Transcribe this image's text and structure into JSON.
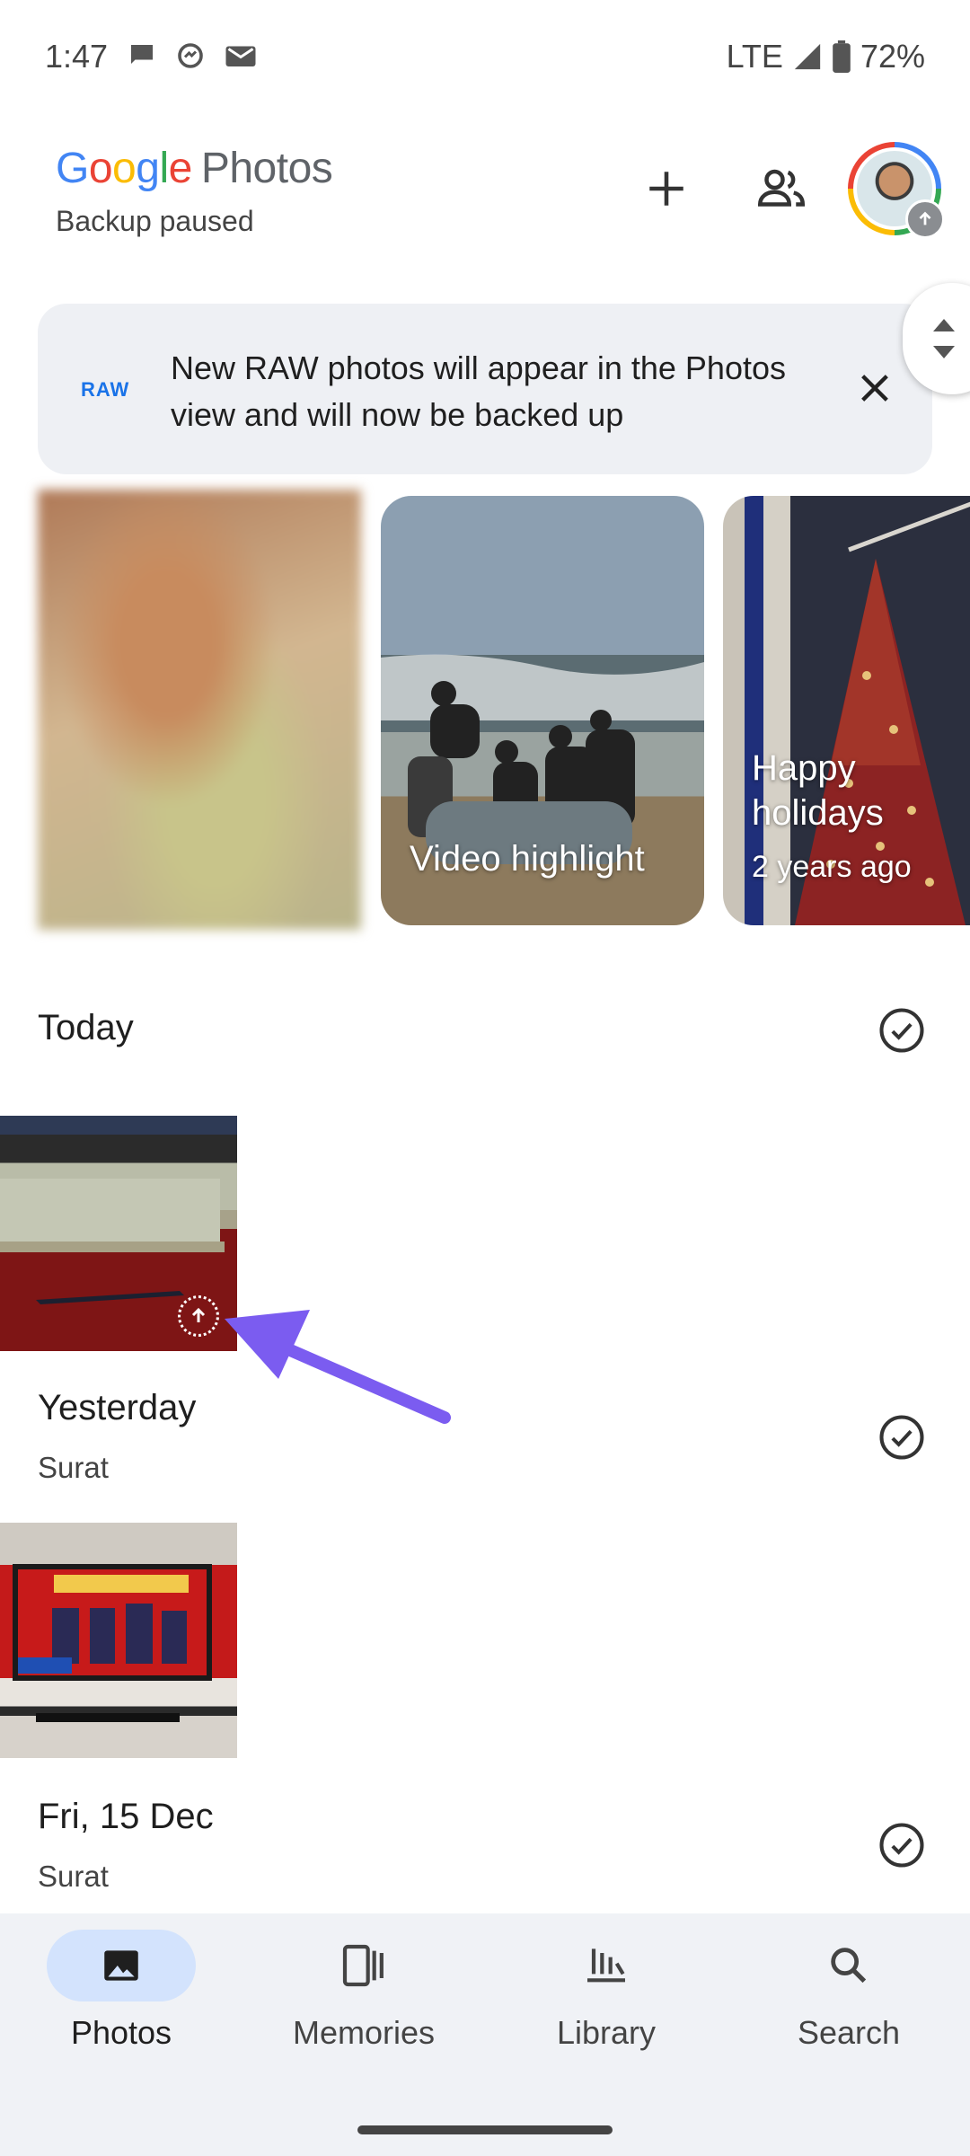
{
  "status": {
    "time": "1:47",
    "network": "LTE",
    "battery": "72%"
  },
  "header": {
    "logo_word": "Google",
    "logo_product": "Photos",
    "subtitle": "Backup paused"
  },
  "banner": {
    "badge": "RAW",
    "message": "New RAW photos will appear in the Photos view and will now be backed up"
  },
  "memories": [
    {
      "caption": "",
      "subcaption": ""
    },
    {
      "caption": "Video highlight",
      "subcaption": ""
    },
    {
      "caption": "Happy holidays",
      "subcaption": "2 years ago"
    }
  ],
  "sections": [
    {
      "title": "Today",
      "location": ""
    },
    {
      "title": "Yesterday",
      "location": "Surat"
    },
    {
      "title": "Fri, 15 Dec",
      "location": "Surat"
    }
  ],
  "nav": [
    {
      "label": "Photos",
      "icon": "photo-icon",
      "active": true
    },
    {
      "label": "Memories",
      "icon": "memories-icon",
      "active": false
    },
    {
      "label": "Library",
      "icon": "library-icon",
      "active": false
    },
    {
      "label": "Search",
      "icon": "search-icon",
      "active": false
    }
  ],
  "annotation": {
    "arrow_color": "#7b5cf0"
  }
}
